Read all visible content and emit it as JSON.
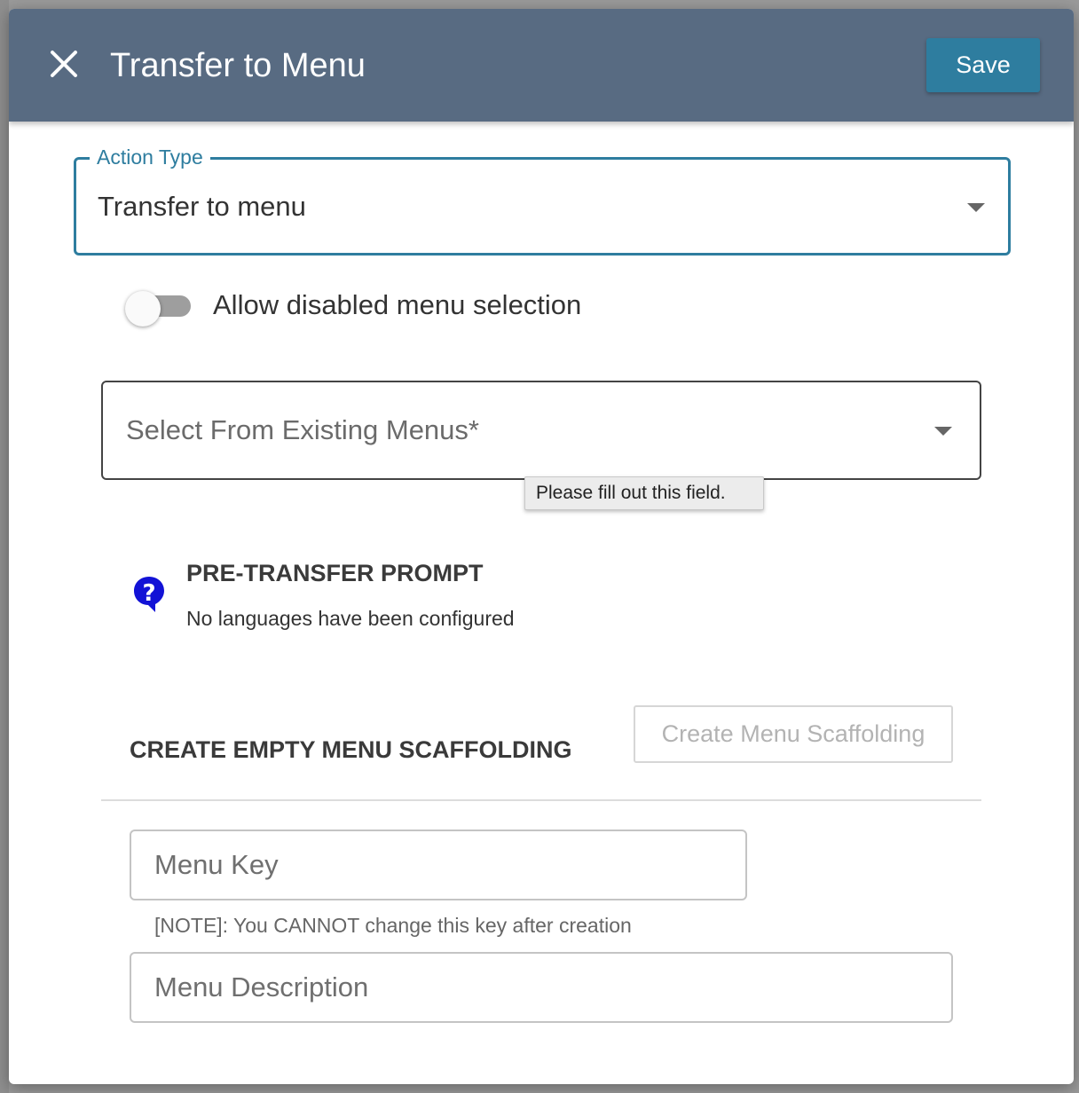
{
  "header": {
    "title": "Transfer to Menu",
    "save_label": "Save",
    "close_icon": "close-icon",
    "background_color": "#586b82",
    "save_color": "#2e7d9f"
  },
  "action_type": {
    "label": "Action Type",
    "value": "Transfer to menu",
    "accent_color": "#2e7d9f"
  },
  "toggle": {
    "label": "Allow disabled menu selection",
    "checked": false
  },
  "menu_select": {
    "placeholder": "Select From Existing Menus*",
    "tooltip": "Please fill out this field."
  },
  "pre_transfer": {
    "icon": "help-icon",
    "title": "PRE-TRANSFER PROMPT",
    "subtitle": "No languages have been configured"
  },
  "scaffolding": {
    "title": "CREATE EMPTY MENU SCAFFOLDING",
    "button_label": "Create Menu Scaffolding",
    "menu_key_placeholder": "Menu Key",
    "menu_key_note": "[NOTE]: You CANNOT change this key after creation",
    "menu_description_placeholder": "Menu Description"
  }
}
